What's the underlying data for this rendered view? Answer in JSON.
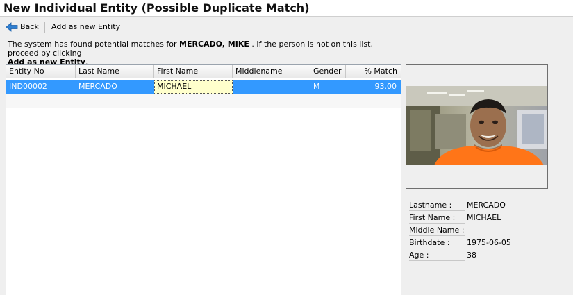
{
  "window": {
    "title": "New Individual Entity (Possible Duplicate Match)"
  },
  "toolbar": {
    "back_label": "Back",
    "add_label": "Add as new Entity"
  },
  "message": {
    "text1": "The system has found potential matches for ",
    "name": "MERCADO, MIKE",
    "text2": " . If the person is not on this list, proceed by clicking",
    "action": "Add as new Entity",
    "end": "."
  },
  "grid": {
    "columns": [
      "Entity No",
      "Last Name",
      "First Name",
      "Middlename",
      "Gender",
      "% Match"
    ],
    "rows": [
      {
        "entity_no": "IND00002",
        "last_name": "MERCADO",
        "first_name": "MICHAEL",
        "middlename": "",
        "gender": "M",
        "match": "93.00"
      }
    ]
  },
  "colors": {
    "selection": "#3399ff",
    "focus_cell": "#ffffcc",
    "back_arrow": "#2f7fd1"
  },
  "icons": {
    "back": "back-arrow-icon"
  },
  "details": {
    "lastname_label": "Lastname :",
    "lastname": "MERCADO",
    "firstname_label": "First Name :",
    "firstname": "MICHAEL",
    "middlename_label": "Middle Name :",
    "middlename": "",
    "birthdate_label": "Birthdate :",
    "birthdate": "1975-06-05",
    "age_label": "Age :",
    "age": "38"
  }
}
